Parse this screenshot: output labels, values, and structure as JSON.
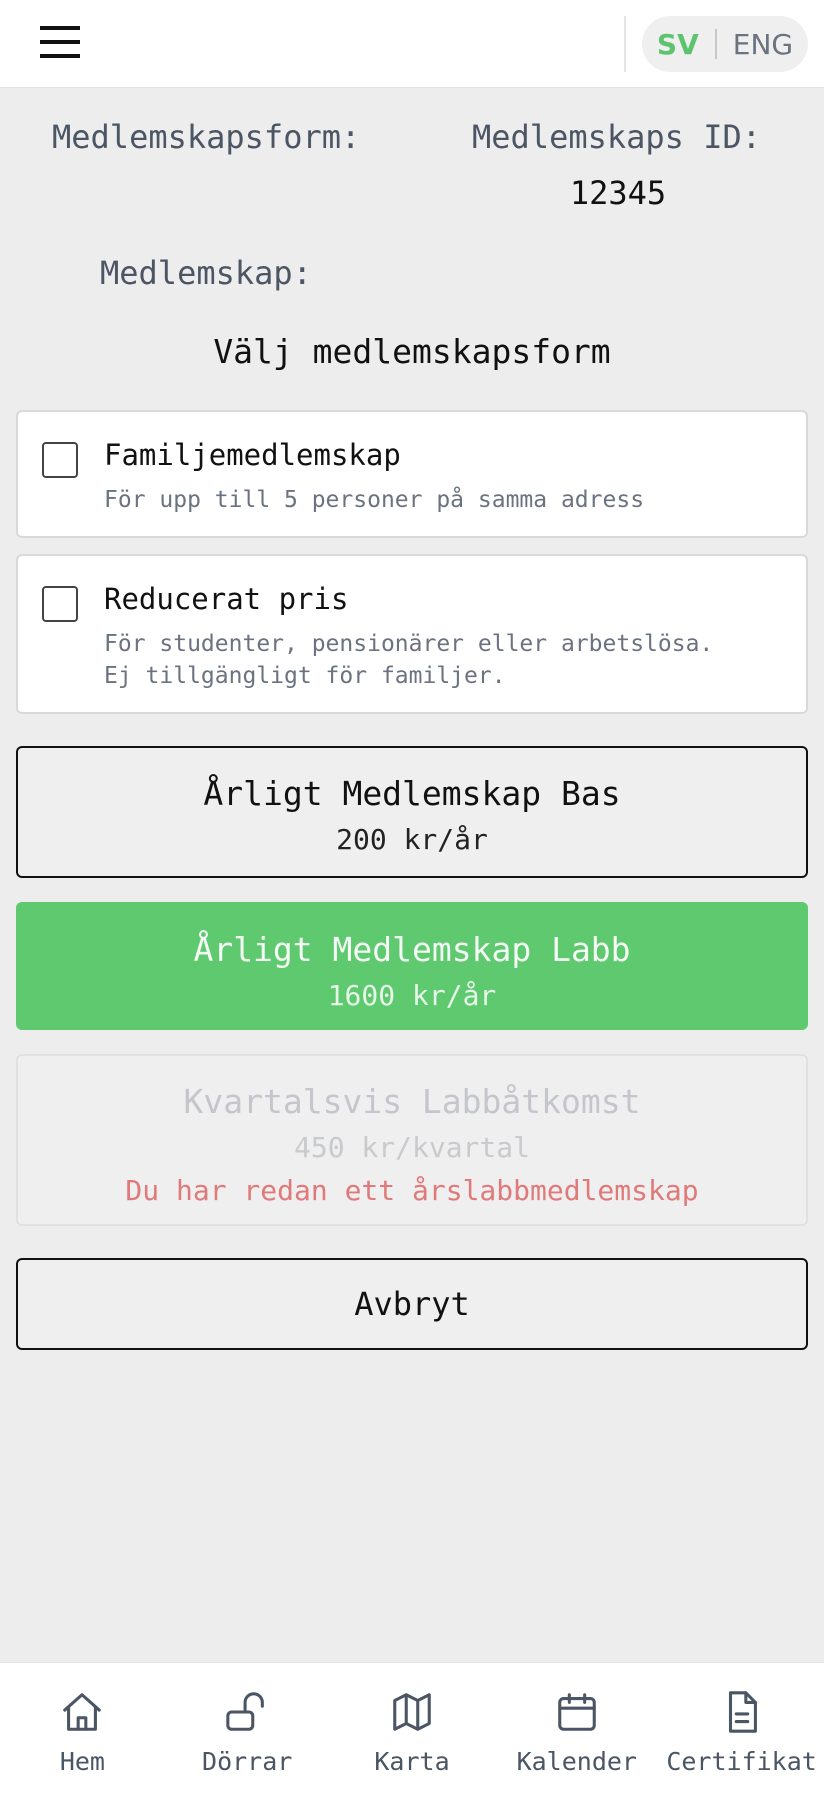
{
  "header": {
    "menu_icon": "hamburger-menu-icon",
    "lang_sv": "SV",
    "lang_eng": "ENG",
    "active_lang_color": "#5cc46e"
  },
  "info": {
    "form_label": "Medlemskapsform:",
    "id_label": "Medlemskaps ID:",
    "id_value": "12345",
    "membership_label": "Medlemskap:",
    "choose_heading": "Välj medlemskapsform"
  },
  "options": [
    {
      "title": "Familjemedlemskap",
      "desc": "För upp till 5 personer på samma adress",
      "checked": false
    },
    {
      "title": "Reducerat pris",
      "desc": "För studenter, pensionärer eller arbetslösa.\nEj tillgängligt för familjer.",
      "checked": false
    }
  ],
  "plans": [
    {
      "name": "Årligt Medlemskap Bas",
      "price": "200 kr/år",
      "state": "default"
    },
    {
      "name": "Årligt Medlemskap Labb",
      "price": "1600 kr/år",
      "state": "selected"
    },
    {
      "name": "Kvartalsvis Labbåtkomst",
      "price": "450 kr/kvartal",
      "state": "disabled",
      "warning": "Du har redan ett årslabbmedlemskap"
    }
  ],
  "cancel_label": "Avbryt",
  "colors": {
    "accent_green": "#5ec96f",
    "warning_red": "#e07a7a",
    "background": "#ededed"
  },
  "nav": [
    {
      "label": "Hem",
      "icon": "home-icon"
    },
    {
      "label": "Dörrar",
      "icon": "unlocked-padlock-icon"
    },
    {
      "label": "Karta",
      "icon": "map-icon"
    },
    {
      "label": "Kalender",
      "icon": "calendar-icon"
    },
    {
      "label": "Certifikat",
      "icon": "document-icon"
    }
  ]
}
